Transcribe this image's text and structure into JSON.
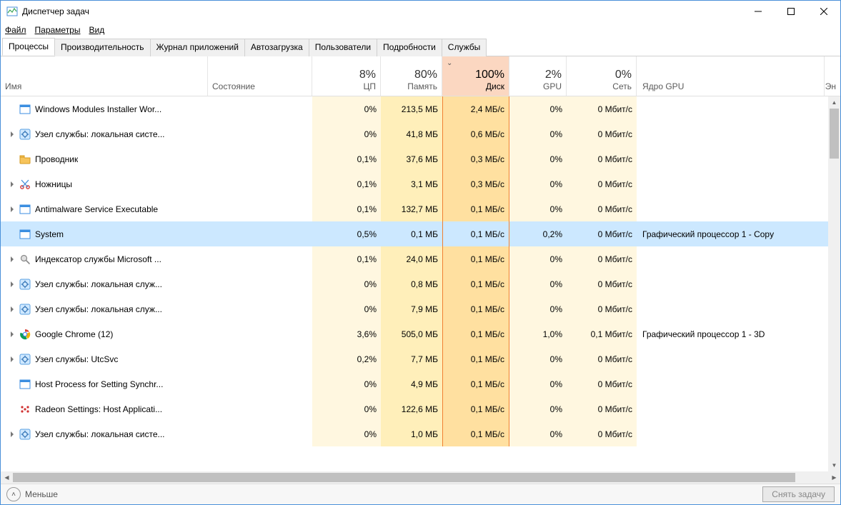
{
  "window": {
    "title": "Диспетчер задач"
  },
  "menu": {
    "file": "Файл",
    "options": "Параметры",
    "view": "Вид"
  },
  "tabs": {
    "processes": "Процессы",
    "performance": "Производительность",
    "app_history": "Журнал приложений",
    "startup": "Автозагрузка",
    "users": "Пользователи",
    "details": "Подробности",
    "services": "Службы"
  },
  "columns": {
    "name": "Имя",
    "state": "Состояние",
    "cpu_pct": "8%",
    "cpu_label": "ЦП",
    "mem_pct": "80%",
    "mem_label": "Память",
    "disk_pct": "100%",
    "disk_label": "Диск",
    "gpu_pct": "2%",
    "gpu_label": "GPU",
    "net_pct": "0%",
    "net_label": "Сеть",
    "gpu_engine": "Ядро GPU",
    "energy_trunc": "Эн"
  },
  "rows": [
    {
      "expand": false,
      "icon": "blue-square",
      "name": "Windows Modules Installer Wor...",
      "cpu": "0%",
      "cpu_h": 0,
      "mem": "213,5 МБ",
      "mem_h": 3,
      "disk": "2,4 МБ/с",
      "disk_h": 4,
      "gpu": "0%",
      "gpu_h": 0,
      "net": "0 Мбит/с",
      "net_h": 0,
      "gpue": ""
    },
    {
      "expand": true,
      "icon": "gear",
      "name": "Узел службы: локальная систе...",
      "cpu": "0%",
      "cpu_h": 0,
      "mem": "41,8 МБ",
      "mem_h": 2,
      "disk": "0,6 МБ/с",
      "disk_h": 3,
      "gpu": "0%",
      "gpu_h": 0,
      "net": "0 Мбит/с",
      "net_h": 0,
      "gpue": ""
    },
    {
      "expand": false,
      "icon": "folder",
      "name": "Проводник",
      "cpu": "0,1%",
      "cpu_h": 0,
      "mem": "37,6 МБ",
      "mem_h": 2,
      "disk": "0,3 МБ/с",
      "disk_h": 1,
      "gpu": "0%",
      "gpu_h": 0,
      "net": "0 Мбит/с",
      "net_h": 0,
      "gpue": ""
    },
    {
      "expand": true,
      "icon": "snip",
      "name": "Ножницы",
      "cpu": "0,1%",
      "cpu_h": 0,
      "mem": "3,1 МБ",
      "mem_h": 1,
      "disk": "0,3 МБ/с",
      "disk_h": 1,
      "gpu": "0%",
      "gpu_h": 0,
      "net": "0 Мбит/с",
      "net_h": 0,
      "gpue": ""
    },
    {
      "expand": true,
      "icon": "blue-square",
      "name": "Antimalware Service Executable",
      "cpu": "0,1%",
      "cpu_h": 0,
      "mem": "132,7 МБ",
      "mem_h": 3,
      "disk": "0,1 МБ/с",
      "disk_h": 1,
      "gpu": "0%",
      "gpu_h": 0,
      "net": "0 Мбит/с",
      "net_h": 0,
      "gpue": ""
    },
    {
      "expand": false,
      "icon": "blue-square",
      "name": "System",
      "cpu": "0,5%",
      "cpu_h": 0,
      "mem": "0,1 МБ",
      "mem_h": 0,
      "disk": "0,1 МБ/с",
      "disk_h": 1,
      "gpu": "0,2%",
      "gpu_h": 0,
      "net": "0 Мбит/с",
      "net_h": 0,
      "gpue": "Графический процессор 1 - Copy",
      "selected": true
    },
    {
      "expand": true,
      "icon": "search",
      "name": "Индексатор службы Microsoft ...",
      "cpu": "0,1%",
      "cpu_h": 0,
      "mem": "24,0 МБ",
      "mem_h": 2,
      "disk": "0,1 МБ/с",
      "disk_h": 1,
      "gpu": "0%",
      "gpu_h": 0,
      "net": "0 Мбит/с",
      "net_h": 0,
      "gpue": ""
    },
    {
      "expand": true,
      "icon": "gear",
      "name": "Узел службы: локальная служ...",
      "cpu": "0%",
      "cpu_h": 0,
      "mem": "0,8 МБ",
      "mem_h": 0,
      "disk": "0,1 МБ/с",
      "disk_h": 1,
      "gpu": "0%",
      "gpu_h": 0,
      "net": "0 Мбит/с",
      "net_h": 0,
      "gpue": ""
    },
    {
      "expand": true,
      "icon": "gear",
      "name": "Узел службы: локальная служ...",
      "cpu": "0%",
      "cpu_h": 0,
      "mem": "7,9 МБ",
      "mem_h": 1,
      "disk": "0,1 МБ/с",
      "disk_h": 1,
      "gpu": "0%",
      "gpu_h": 0,
      "net": "0 Мбит/с",
      "net_h": 0,
      "gpue": ""
    },
    {
      "expand": true,
      "icon": "chrome",
      "name": "Google Chrome (12)",
      "cpu": "3,6%",
      "cpu_h": 2,
      "mem": "505,0 МБ",
      "mem_h": 4,
      "disk": "0,1 МБ/с",
      "disk_h": 1,
      "gpu": "1,0%",
      "gpu_h": 1,
      "net": "0,1 Мбит/с",
      "net_h": 1,
      "gpue": "Графический процессор 1 - 3D"
    },
    {
      "expand": true,
      "icon": "gear",
      "name": "Узел службы: UtcSvc",
      "cpu": "0,2%",
      "cpu_h": 0,
      "mem": "7,7 МБ",
      "mem_h": 1,
      "disk": "0,1 МБ/с",
      "disk_h": 1,
      "gpu": "0%",
      "gpu_h": 0,
      "net": "0 Мбит/с",
      "net_h": 0,
      "gpue": ""
    },
    {
      "expand": false,
      "icon": "blue-square",
      "name": "Host Process for Setting Synchr...",
      "cpu": "0%",
      "cpu_h": 0,
      "mem": "4,9 МБ",
      "mem_h": 1,
      "disk": "0,1 МБ/с",
      "disk_h": 1,
      "gpu": "0%",
      "gpu_h": 0,
      "net": "0 Мбит/с",
      "net_h": 0,
      "gpue": ""
    },
    {
      "expand": false,
      "icon": "radeon",
      "name": "Radeon Settings: Host Applicati...",
      "cpu": "0%",
      "cpu_h": 0,
      "mem": "122,6 МБ",
      "mem_h": 3,
      "disk": "0,1 МБ/с",
      "disk_h": 1,
      "gpu": "0%",
      "gpu_h": 0,
      "net": "0 Мбит/с",
      "net_h": 0,
      "gpue": ""
    },
    {
      "expand": true,
      "icon": "gear",
      "name": "Узел службы: локальная систе...",
      "cpu": "0%",
      "cpu_h": 0,
      "mem": "1,0 МБ",
      "mem_h": 0,
      "disk": "0,1 МБ/с",
      "disk_h": 1,
      "gpu": "0%",
      "gpu_h": 0,
      "net": "0 Мбит/с",
      "net_h": 0,
      "gpue": ""
    }
  ],
  "footer": {
    "fewer": "Меньше",
    "end_task": "Снять задачу"
  }
}
